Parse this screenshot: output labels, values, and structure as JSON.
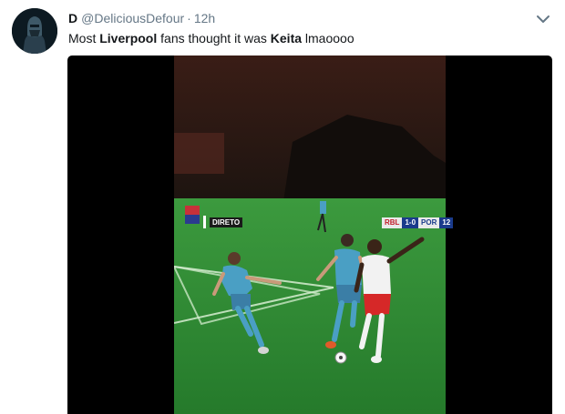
{
  "tweet": {
    "display_name": "D",
    "handle": "@DeliciousDefour",
    "separator": "·",
    "time": "12h",
    "text_parts": [
      "Most ",
      "Liverpool",
      " fans thought it was ",
      "Keita",
      " lmaoooo"
    ]
  },
  "video": {
    "scorebug": {
      "live_label": "DIRETO",
      "home_team": "RBL",
      "score": "1-0",
      "away_team": "POR",
      "clock": "12"
    }
  },
  "colors": {
    "name_text": "#14171a",
    "meta_text": "#657786",
    "pitch_green": "#2f8a33",
    "porto_kit": "#4a9fc4",
    "leipzig_kit": "#f2f2f2",
    "leipzig_shorts": "#d62828"
  }
}
